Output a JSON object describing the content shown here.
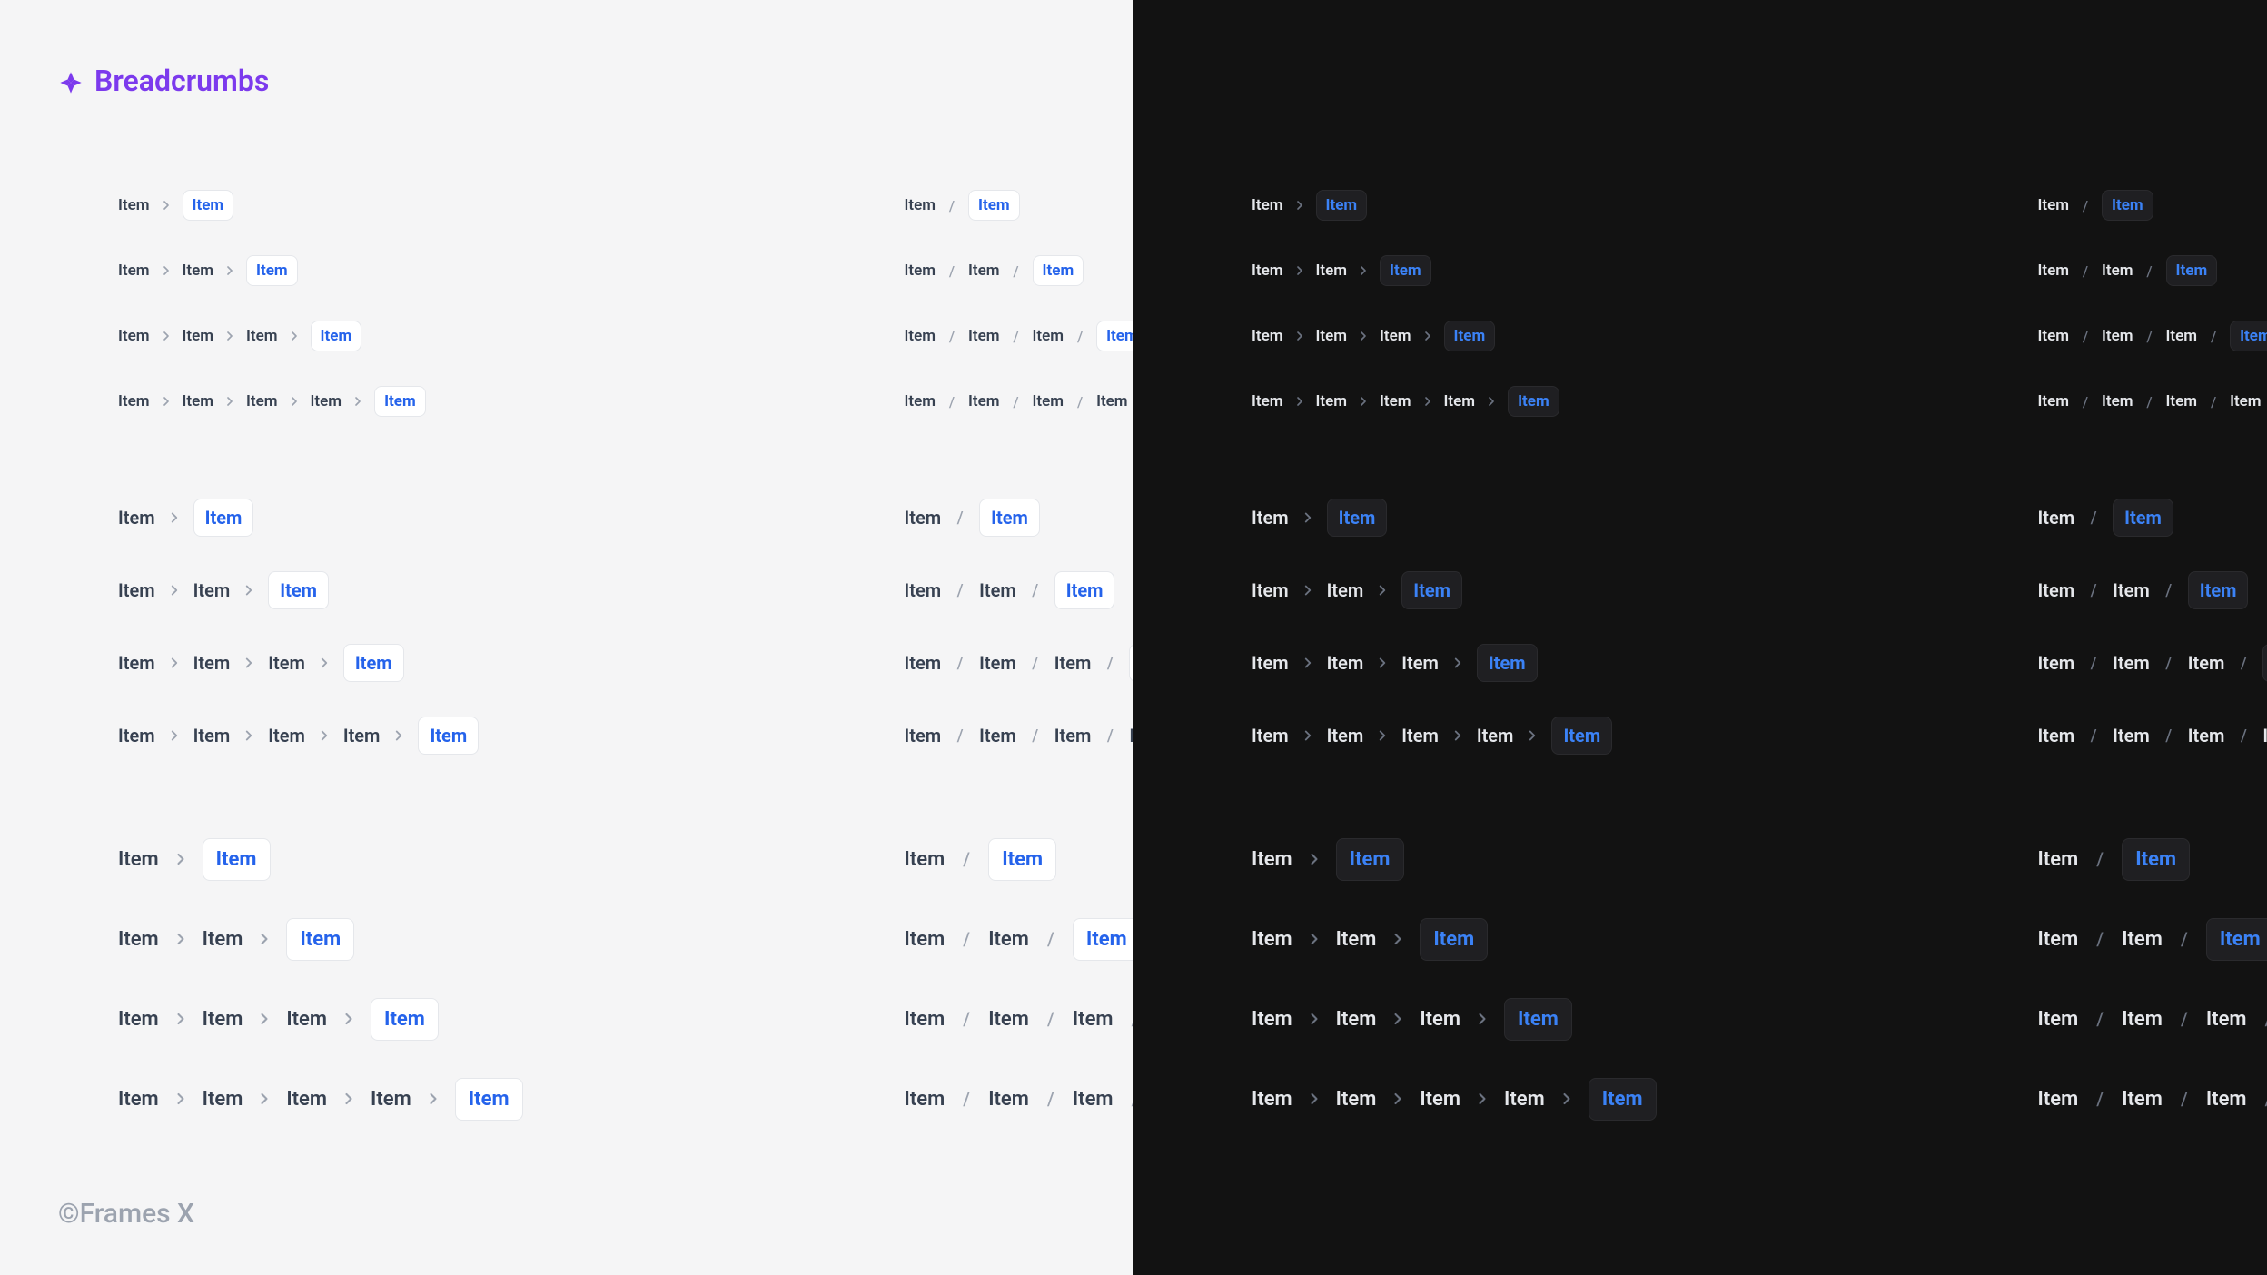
{
  "header": {
    "title": "Breadcrumbs",
    "accent_color": "#7c3aed"
  },
  "footer": {
    "copyright": "©Frames X"
  },
  "crumb_label": "Item",
  "separators": {
    "chevron": "chevron",
    "slash": "/"
  },
  "themes": [
    "light",
    "dark"
  ],
  "sizes": [
    "sm",
    "md",
    "lg"
  ],
  "separator_styles": [
    "chevron",
    "slash"
  ],
  "row_depths": [
    2,
    3,
    4,
    5
  ],
  "colors": {
    "active_blue_light": "#2563eb",
    "active_blue_dark": "#3b82f6",
    "bg_light": "#f5f5f6",
    "bg_dark": "#121212"
  }
}
